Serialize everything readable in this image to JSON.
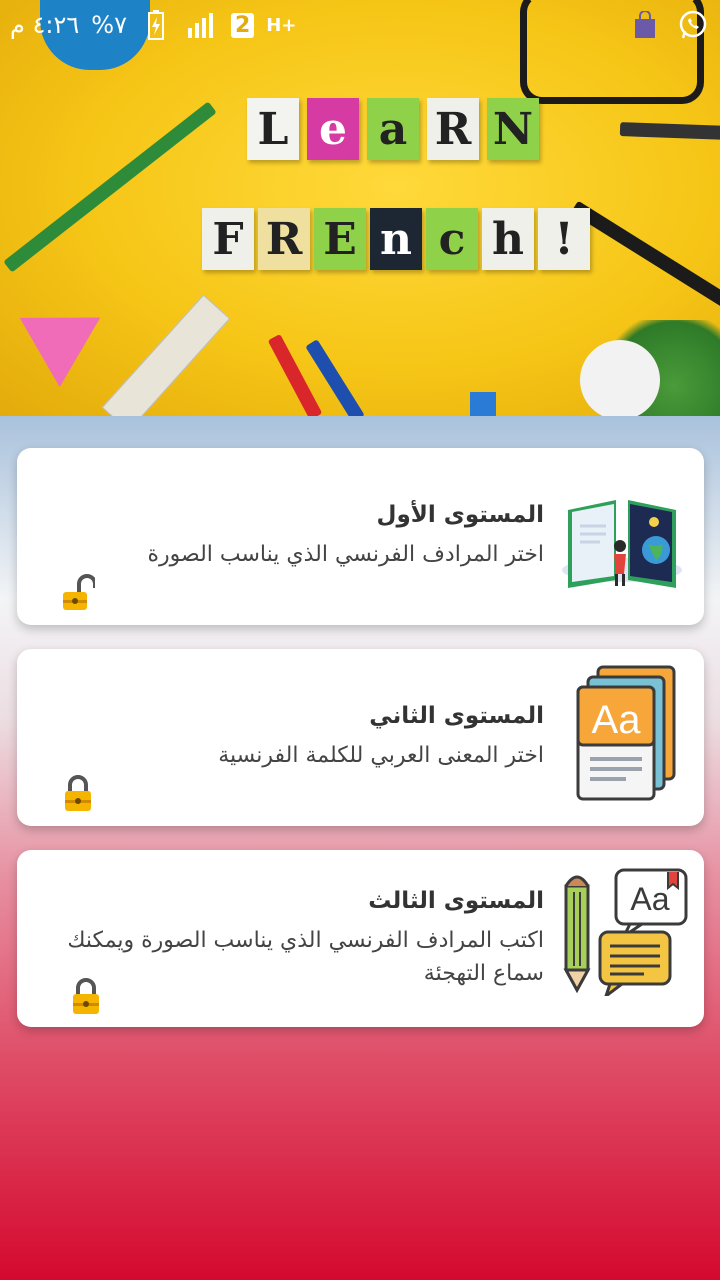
{
  "status_bar": {
    "time": "٤:٢٦ م",
    "battery": "%٧",
    "sim": "2",
    "network": "H+"
  },
  "hero": {
    "line1": [
      "L",
      "e",
      "a",
      "R",
      "N"
    ],
    "line2": [
      "F",
      "R",
      "E",
      "n",
      "c",
      "h",
      "!"
    ],
    "line1_colors": [
      "#f3f3ef",
      "#d63ba4",
      "#8fd24a",
      "#f0f0ea",
      "#8fd24a"
    ],
    "line2_colors": [
      "#f0f0ea",
      "#efe0a0",
      "#8fd24a",
      "#1d2733",
      "#8fd24a",
      "#f0f0ea",
      "#f0f0ea"
    ]
  },
  "levels": [
    {
      "title": "المستوى الأول",
      "subtitle": "اختر المرادف الفرنسي الذي يناسب الصورة",
      "icon": "book-illustration-icon",
      "lock": "unlocked"
    },
    {
      "title": "المستوى الثاني",
      "subtitle": "اختر المعنى العربي للكلمة الفرنسية",
      "icon": "dictionary-cards-icon",
      "lock": "locked"
    },
    {
      "title": "المستوى الثالث",
      "subtitle": "اكتب المرادف الفرنسي الذي يناسب الصورة ويمكنك سماع التهجئة",
      "icon": "pencil-speech-icon",
      "lock": "locked"
    }
  ]
}
